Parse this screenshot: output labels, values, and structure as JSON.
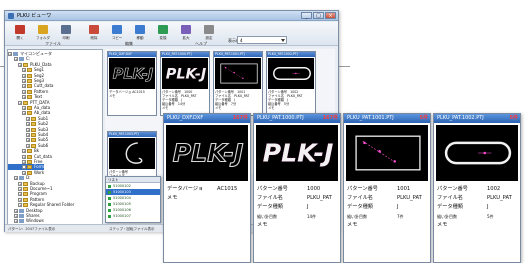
{
  "window": {
    "title": "PLKU ビューワ",
    "controls": [
      "_",
      "□",
      "×"
    ]
  },
  "toolbar": {
    "buttons": [
      {
        "label": "開く",
        "icon": "open-icon",
        "color": "#c0392b"
      },
      {
        "label": "フォルダ",
        "icon": "folder-icon",
        "color": "#d9a520"
      },
      {
        "label": "印刷",
        "icon": "print-icon",
        "color": "#5a6f8f"
      },
      {
        "label": "削除",
        "icon": "delete-icon",
        "color": "#c94a3a"
      },
      {
        "label": "コピー",
        "icon": "copy-icon",
        "color": "#3b7bd0"
      },
      {
        "label": "移動",
        "icon": "move-icon",
        "color": "#3b7bd0"
      },
      {
        "label": "変換",
        "icon": "convert-icon",
        "color": "#2e9b52"
      },
      {
        "label": "拡大",
        "icon": "zoom-icon",
        "color": "#7a5fb8"
      },
      {
        "label": "設定",
        "icon": "settings-icon",
        "color": "#8a8a8a"
      }
    ],
    "section_labels": [
      "ファイル",
      "編集",
      "ヘルプ"
    ],
    "display_label": "表示件数",
    "display_value": "4"
  },
  "tree": {
    "items": [
      "マイコンピュータ",
      "C:",
      "PLKU_Data",
      "Seg1",
      "Seg2",
      "Seg3",
      "Cutt_data",
      "Pattern",
      "Text",
      "PTT_DATA",
      "Aa_data",
      "Ab_data",
      "Sub1",
      "Sub2",
      "Sub3",
      "Sub4",
      "Sub5",
      "Sub6",
      "Bk",
      "Cut_data",
      "Free",
      "Form",
      "Work",
      "D:",
      "Backup",
      "Docume~1",
      "Program",
      "Pattern",
      "Regular Shared Folder",
      "Desktop",
      "Shares",
      "Windows"
    ],
    "status": "パターン：2047ファイル表示"
  },
  "popup_list": {
    "header": "リスト",
    "items": [
      "51000102",
      "51000103",
      "51000104",
      "51000105",
      "51000106",
      "51000107"
    ]
  },
  "status_bar": {
    "left": "パターン：2047ファイル表示",
    "right": "ステップ・回転ファイル表示"
  },
  "small_cards": [
    {
      "title": "PLKU_DXF.DXF",
      "lines": [
        "データバージョ AC1015",
        "メモ"
      ]
    },
    {
      "title": "PLKU_PAT.1000.PTJ",
      "lines": [
        "パターン番号　1000",
        "ファイル名　PLKU_PAT",
        "データ種類　J",
        "組込番号　14分",
        "メモ"
      ]
    },
    {
      "title": "PLKU_PAT.1001.PTJ",
      "lines": [
        "パターン番号　1001",
        "ファイル名　PLKU_PAT",
        "データ種類　J",
        "組込番号　7分",
        "メモ"
      ]
    },
    {
      "title": "PLKU_PAT.1002.PTJ",
      "lines": [
        "パターン番号　1002",
        "ファイル名　PLKU_PAT",
        "データ種類　J",
        "組込番号　5分",
        "メモ"
      ]
    },
    {
      "title": "PLKU_PAT.1003.PTJ",
      "lines": [
        "パターン番号",
        "ファイル名"
      ]
    }
  ],
  "big_cards": [
    {
      "title": "PLKU_DXF.DXF",
      "count": "167件",
      "rows": [
        {
          "k": "データバージョ",
          "v": "AC1015"
        },
        {
          "k": "メモ",
          "v": ""
        }
      ]
    },
    {
      "title": "PLKU_PAT.1000.PTJ",
      "count": "167件",
      "rows": [
        {
          "k": "パターン番号",
          "v": "1000"
        },
        {
          "k": "ファイル名",
          "v": "PLKU_PAT"
        },
        {
          "k": "データ種類",
          "v": "J"
        },
        {
          "k": "縫い針目数",
          "v": "14件"
        },
        {
          "k": "メモ",
          "v": ""
        }
      ]
    },
    {
      "title": "PLKU_PAT.1001.PTJ",
      "count": "5件",
      "rows": [
        {
          "k": "パターン番号",
          "v": "1001"
        },
        {
          "k": "ファイル名",
          "v": "PLKU_PAT"
        },
        {
          "k": "データ種類",
          "v": "J"
        },
        {
          "k": "縫い針目数",
          "v": "7件"
        },
        {
          "k": "メモ",
          "v": ""
        }
      ]
    },
    {
      "title": "PLKU_PAT.1002.PTJ",
      "count": "5件",
      "rows": [
        {
          "k": "パターン番号",
          "v": "1002"
        },
        {
          "k": "ファイル名",
          "v": "PLKU_PAT"
        },
        {
          "k": "データ種類",
          "v": "J"
        },
        {
          "k": "縫い針目数",
          "v": "5件"
        },
        {
          "k": "メモ",
          "v": ""
        }
      ]
    }
  ],
  "logo_text": "PLK-J",
  "colors": {
    "title_blue": "#2f66b6",
    "count_red": "#ff3a3a",
    "pattern_magenta": "#ff4fd0"
  }
}
